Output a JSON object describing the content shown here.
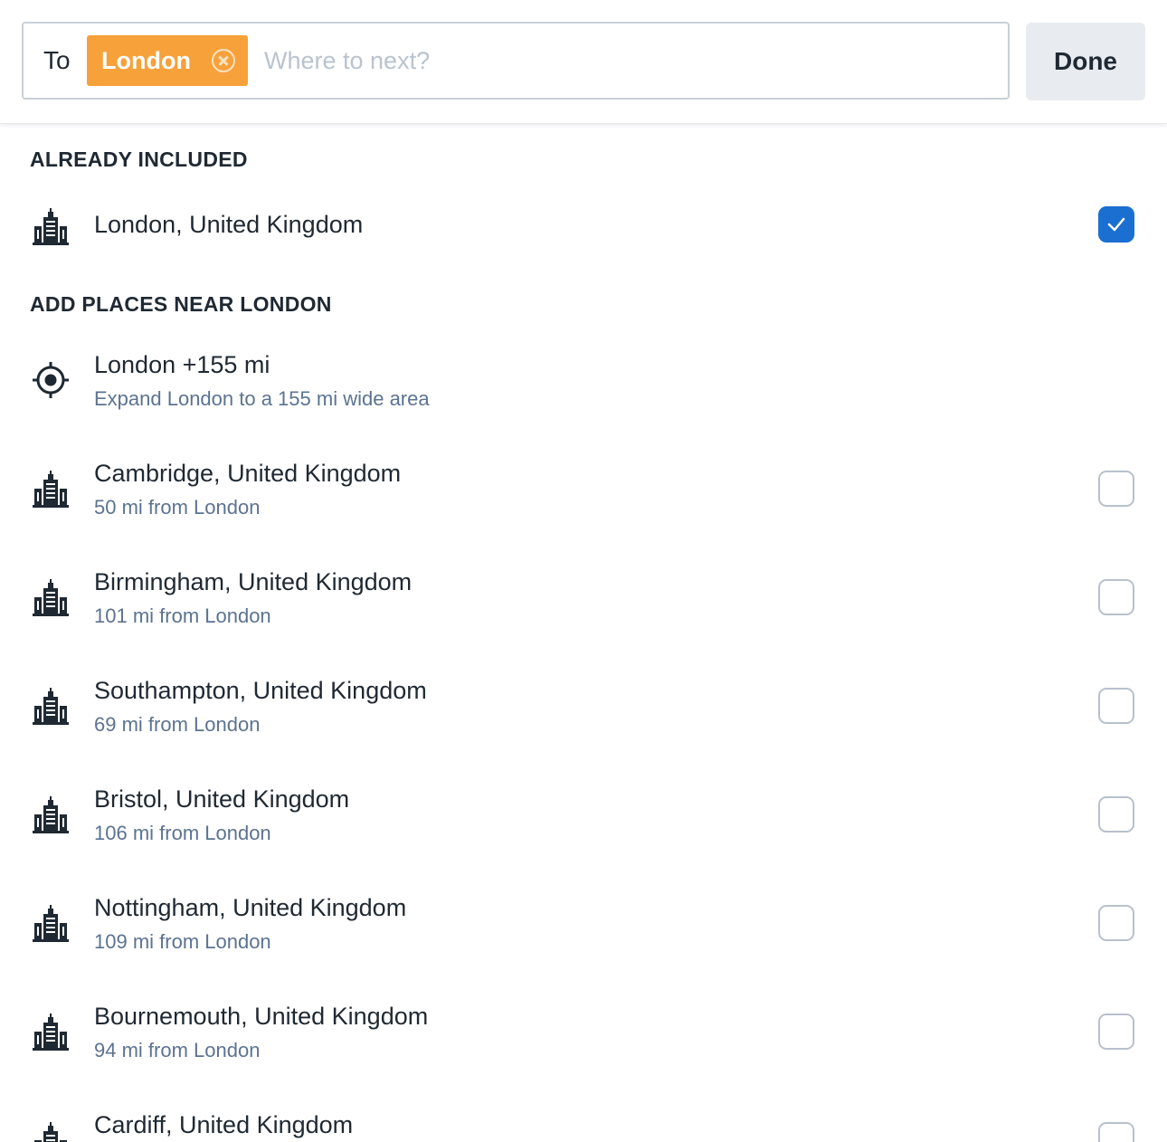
{
  "search": {
    "to_label": "To",
    "chip_label": "London",
    "placeholder": "Where to next?",
    "done_label": "Done"
  },
  "sections": {
    "included_heading": "ALREADY INCLUDED",
    "nearby_heading": "ADD PLACES NEAR LONDON"
  },
  "included": {
    "title": "London, United Kingdom",
    "checked": true,
    "icon": "city-icon"
  },
  "expand": {
    "title": "London +155 mi",
    "subtitle": "Expand London to a 155 mi wide area",
    "icon": "target-location-icon"
  },
  "places": [
    {
      "title": "Cambridge, United Kingdom",
      "subtitle": "50 mi from London",
      "checked": false,
      "icon": "city-icon"
    },
    {
      "title": "Birmingham, United Kingdom",
      "subtitle": "101 mi from London",
      "checked": false,
      "icon": "city-icon"
    },
    {
      "title": "Southampton, United Kingdom",
      "subtitle": "69 mi from London",
      "checked": false,
      "icon": "city-icon"
    },
    {
      "title": "Bristol, United Kingdom",
      "subtitle": "106 mi from London",
      "checked": false,
      "icon": "city-icon"
    },
    {
      "title": "Nottingham, United Kingdom",
      "subtitle": "109 mi from London",
      "checked": false,
      "icon": "city-icon"
    },
    {
      "title": "Bournemouth, United Kingdom",
      "subtitle": "94 mi from London",
      "checked": false,
      "icon": "city-icon"
    },
    {
      "title": "Cardiff, United Kingdom",
      "subtitle": "",
      "checked": false,
      "icon": "city-icon"
    }
  ],
  "colors": {
    "chip": "#f7a13a",
    "checkbox_checked": "#1a6fd1",
    "subtitle": "#5c7391",
    "done_bg": "#e8ecf0"
  }
}
